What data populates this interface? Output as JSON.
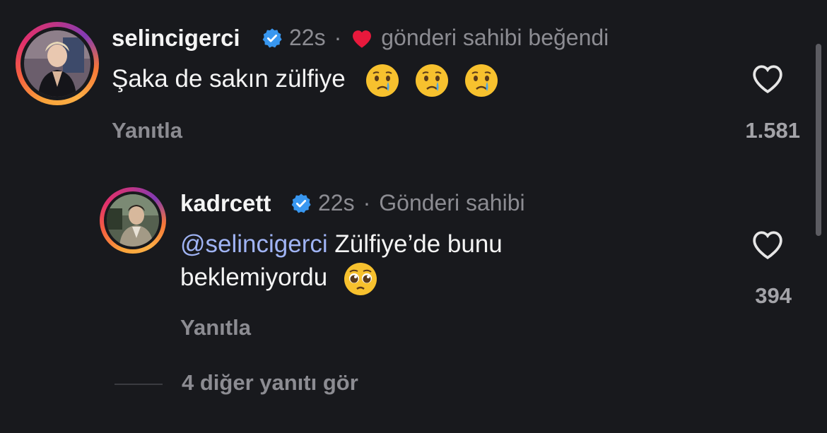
{
  "comment": {
    "username": "selincigerci",
    "time": "22s",
    "separator": "·",
    "liked_by_author": "gönderi sahibi beğendi",
    "text": "Şaka de sakın zülfiye",
    "emojis": [
      "crying-face",
      "crying-face",
      "crying-face"
    ],
    "reply_label": "Yanıtla",
    "like_count": "1.581",
    "heart_color": "#e8193c"
  },
  "reply": {
    "username": "kadrcett",
    "time": "22s",
    "separator": "·",
    "author_badge": "Gönderi sahibi",
    "mention": "@selincigerci",
    "text_line1": "Zülfiye’de bunu",
    "text_line2": "beklemiyordu",
    "emoji": "pleading-face",
    "reply_label": "Yanıtla",
    "like_count": "394"
  },
  "more_replies": "4 diğer yanıtı gör",
  "colors": {
    "background": "#18191d",
    "verified": "#3897f0",
    "mention": "#a0b4f5",
    "secondary_text": "#8c8c92"
  }
}
